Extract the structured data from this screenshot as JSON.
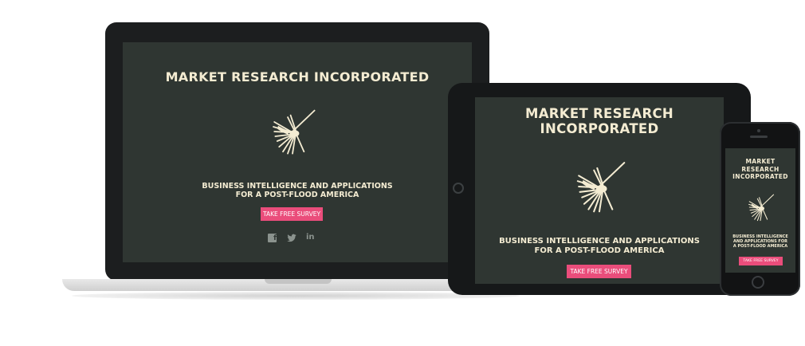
{
  "colors": {
    "screen_background": "#2f3632",
    "title_text": "#f4ecd2",
    "cta_background": "#ea4d7b",
    "cta_text": "#ffffff",
    "social_icon": "#8b938e"
  },
  "laptop": {
    "title": "MARKET RESEARCH INCORPORATED",
    "logo_icon": "nazca-bird-icon",
    "subtitle_line1": "BUSINESS INTELLIGENCE AND APPLICATIONS",
    "subtitle_line2": "FOR A POST-FLOOD AMERICA",
    "cta_label": "TAKE FREE SURVEY",
    "social": {
      "facebook_glyph": "f",
      "twitter_icon": "twitter-bird-icon",
      "linkedin_glyph": "in"
    }
  },
  "tablet": {
    "title_line1": "MARKET RESEARCH",
    "title_line2": "INCORPORATED",
    "logo_icon": "nazca-bird-icon",
    "subtitle_line1": "BUSINESS INTELLIGENCE AND APPLICATIONS",
    "subtitle_line2": "FOR A POST-FLOOD AMERICA",
    "cta_label": "TAKE FREE SURVEY"
  },
  "phone": {
    "title_line1": "MARKET",
    "title_line2": "RESEARCH",
    "title_line3": "INCORPORATED",
    "logo_icon": "nazca-bird-icon",
    "subtitle_line1": "BUSINESS INTELLIGENCE",
    "subtitle_line2": "AND APPLICATIONS FOR",
    "subtitle_line3": "A POST-FLOOD AMERICA",
    "cta_label": "TAKE FREE SURVEY"
  }
}
